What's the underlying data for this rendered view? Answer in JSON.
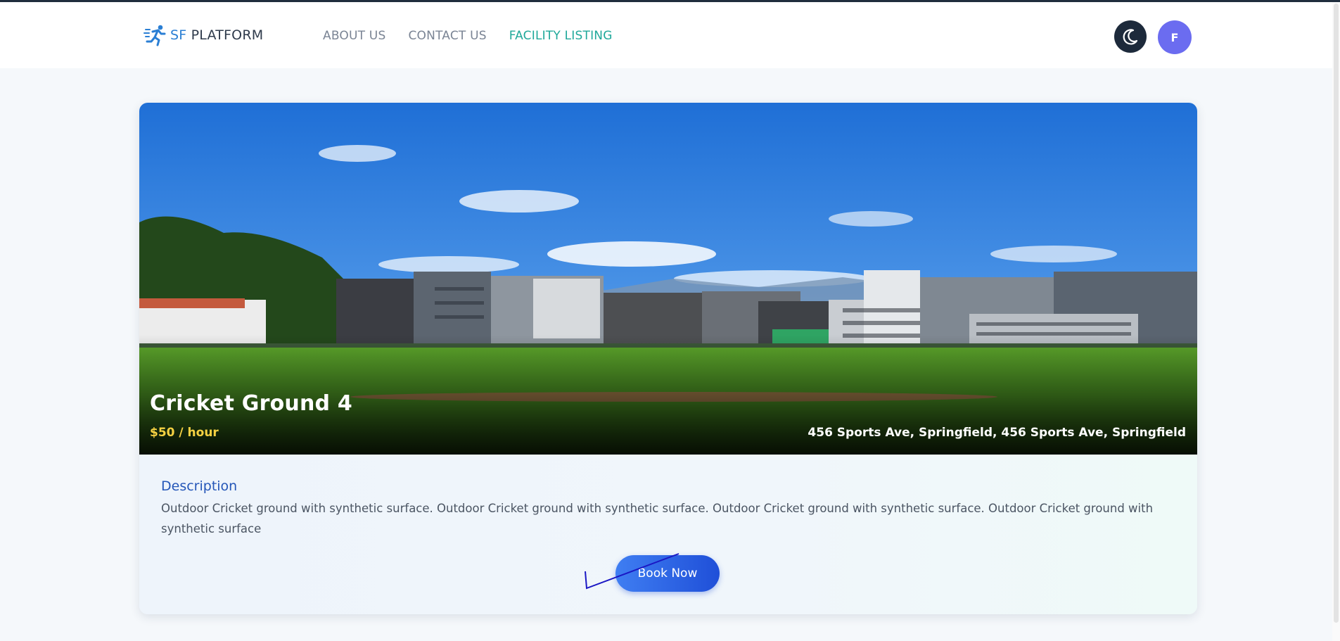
{
  "brand": {
    "sf": "SF",
    "platform": "PLATFORM"
  },
  "nav": {
    "about": "ABOUT US",
    "contact": "CONTACT US",
    "facility": "FACILITY LISTING"
  },
  "user": {
    "initial": "F"
  },
  "facility": {
    "title": "Cricket Ground 4",
    "price": "$50 / hour",
    "address": "456 Sports Ave, Springfield, 456 Sports Ave, Springfield",
    "description_heading": "Description",
    "description": "Outdoor Cricket ground with synthetic surface. Outdoor Cricket ground with synthetic surface. Outdoor Cricket ground with synthetic surface. Outdoor Cricket ground with synthetic surface",
    "book_label": "Book Now"
  },
  "icons": {
    "brand": "running-person-icon",
    "theme": "moon-icon"
  },
  "colors": {
    "accent": "#1fa89a",
    "brand_blue": "#2b7fd4",
    "price": "#f5d142",
    "button": "#2a5fe0"
  }
}
